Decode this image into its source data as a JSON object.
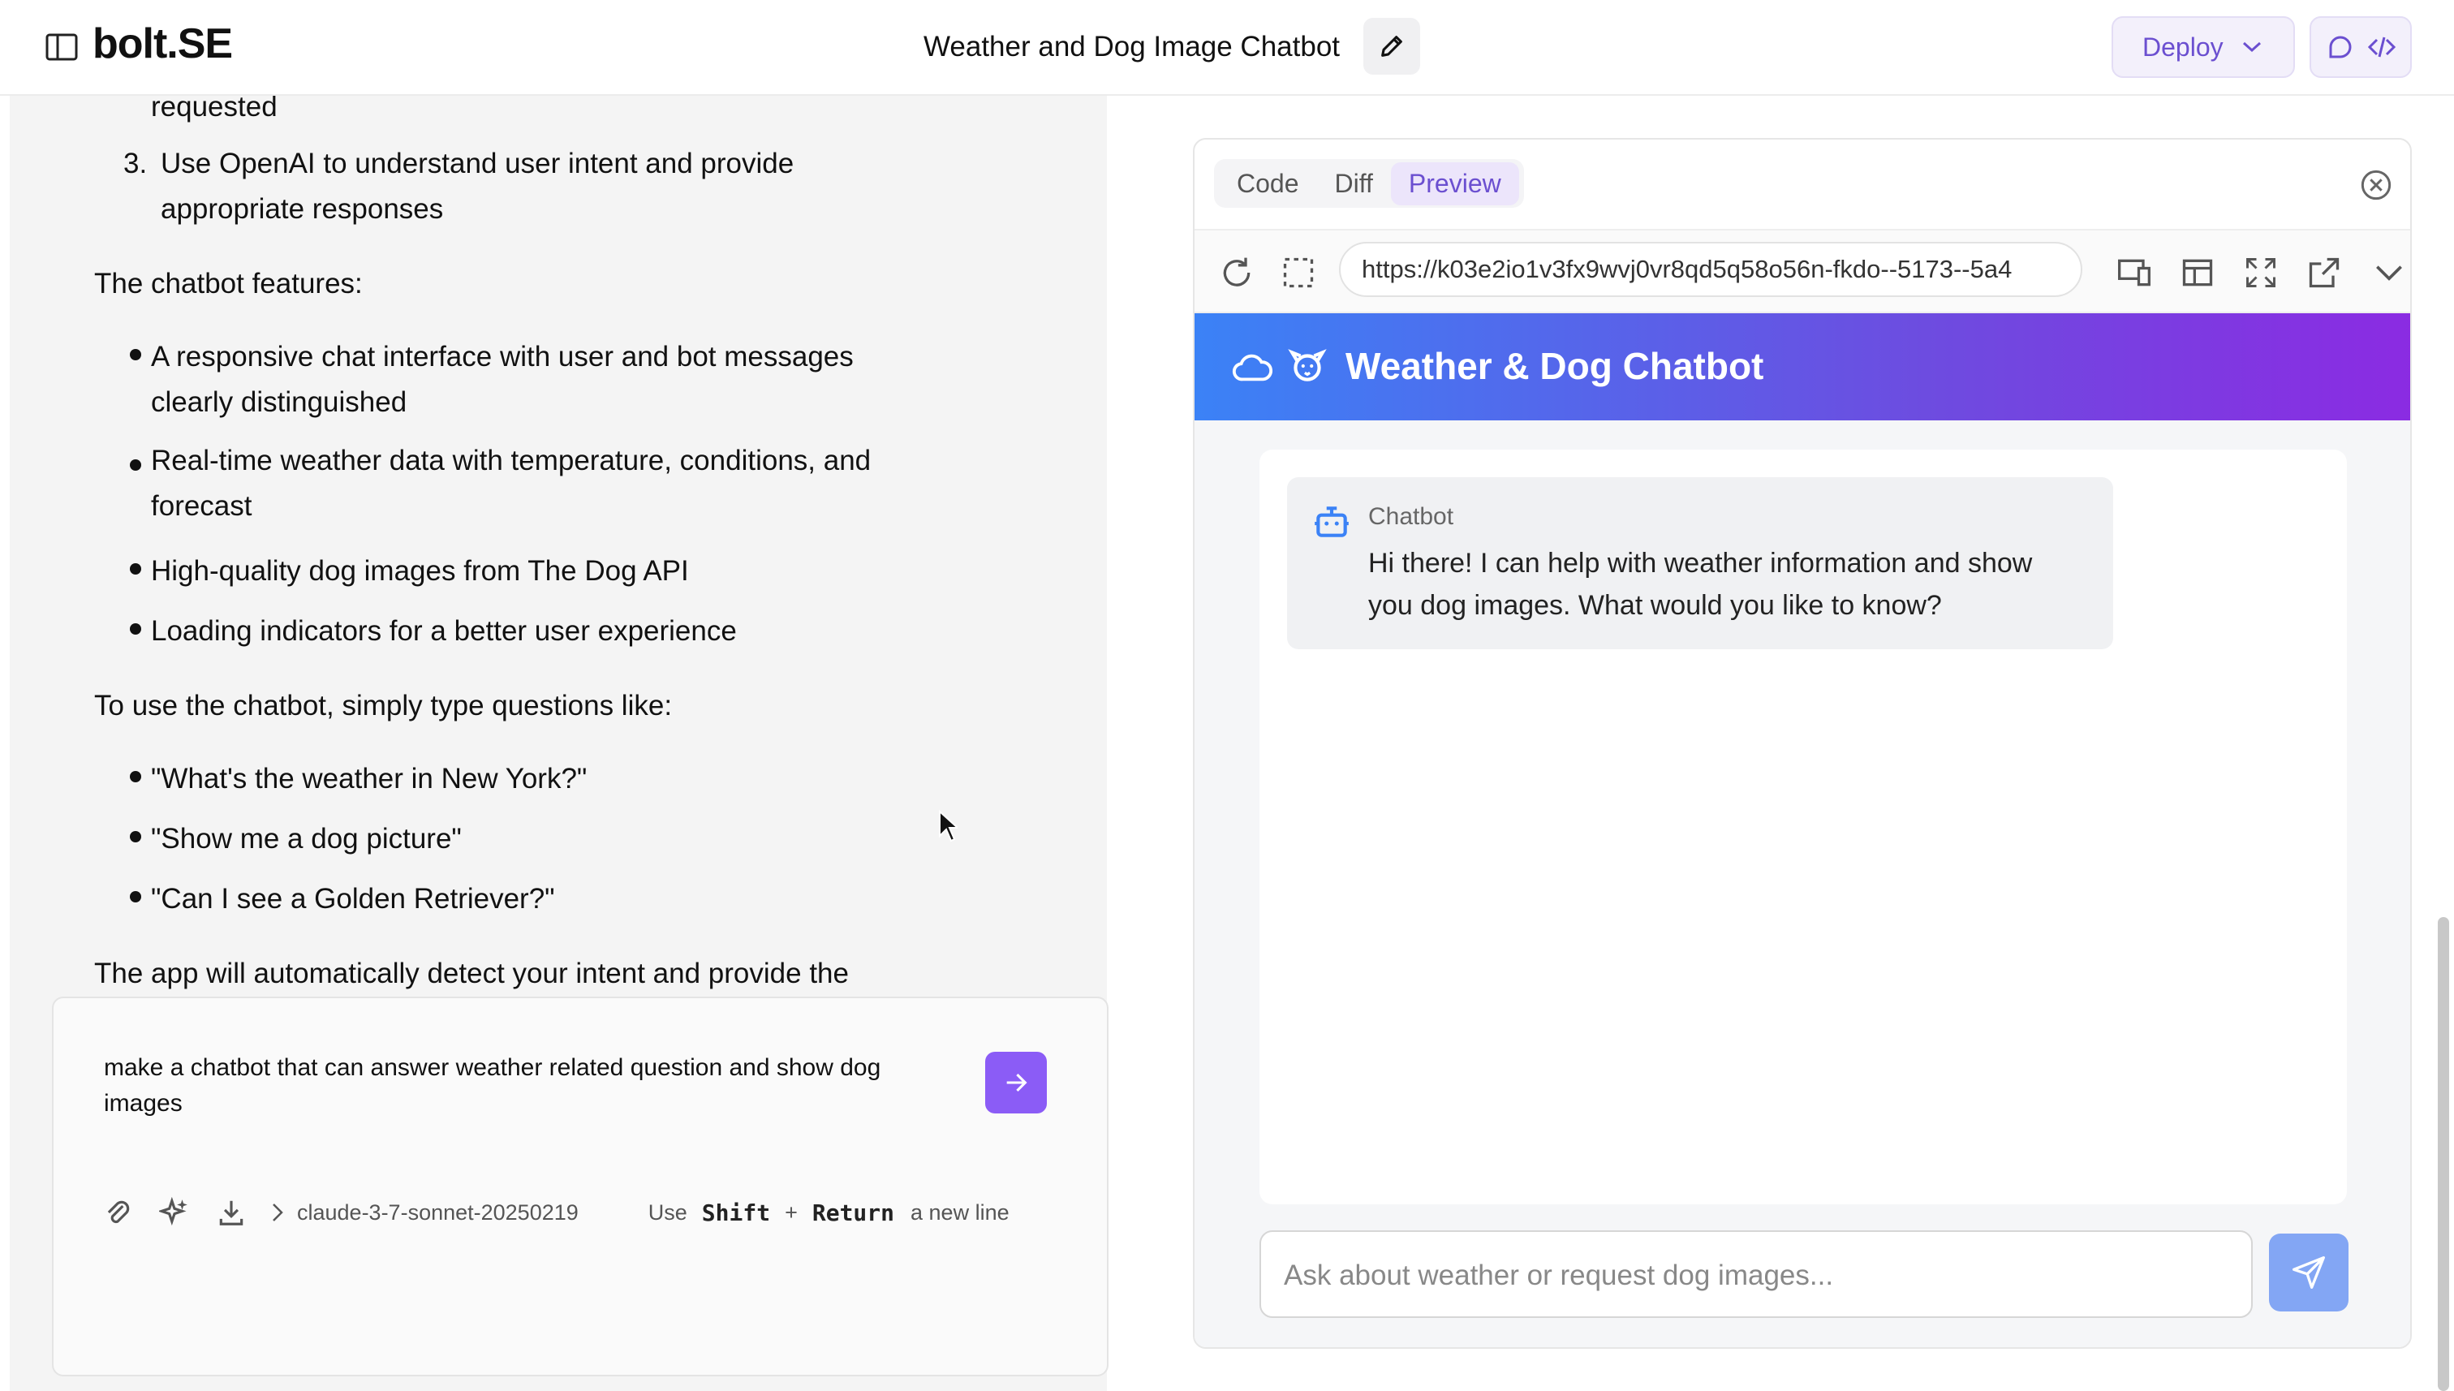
{
  "header": {
    "brand": "bolt.SE",
    "project_title": "Weather and Dog Image Chatbot",
    "deploy_label": "Deploy"
  },
  "chat": {
    "fragment": "requested",
    "ordered_item": {
      "number": "3.",
      "text": "Use OpenAI to understand user intent and provide appropriate responses"
    },
    "features_heading": "The chatbot features:",
    "features": [
      "A responsive chat interface with user and bot messages clearly distinguished",
      "Real-time weather data with temperature, conditions, and forecast",
      "High-quality dog images from The Dog API",
      "Loading indicators for a better user experience"
    ],
    "usage_heading": "To use the chatbot, simply type questions like:",
    "examples": [
      "\"What's the weather in New York?\"",
      "\"Show me a dog picture\"",
      "\"Can I see a Golden Retriever?\""
    ],
    "closing": "The app will automatically detect your intent and provide the appropriate response with either weather information or a dog image."
  },
  "input": {
    "value": "make a chatbot that can answer weather related question and show dog images",
    "model": "claude-3-7-sonnet-20250219",
    "hint_use": "Use",
    "hint_shift": "Shift",
    "hint_plus": "+",
    "hint_return": "Return",
    "hint_rest": "a new line"
  },
  "workbench": {
    "tabs": [
      "Code",
      "Diff",
      "Preview"
    ],
    "active_tab": "Preview",
    "url": "https://k03e2io1v3fx9wvj0vr8qd5q58o56n-fkdo--5173--5a4"
  },
  "preview_app": {
    "title": "Weather & Dog Chatbot",
    "bot_name": "Chatbot",
    "bot_message": "Hi there! I can help with weather information and show you dog images. What would you like to know?",
    "input_placeholder": "Ask about weather or request dog images..."
  },
  "icons": {
    "sidebar_toggle": "sidebar-icon",
    "edit": "pencil-icon",
    "chevron": "chevron-down-icon",
    "attach": "paperclip-icon",
    "enhance": "sparkles-icon",
    "download": "download-icon",
    "reload": "reload-icon",
    "select": "select-element-icon",
    "devices": "device-icon",
    "layout": "layout-icon",
    "fullscreen": "fullscreen-icon",
    "external": "external-link-icon",
    "cloud": "cloud-icon",
    "dog": "dog-icon",
    "bot": "robot-icon",
    "send": "send-icon"
  },
  "colors": {
    "accent": "#8b5cf6",
    "deploy_text": "#6b4fd0",
    "gradient_start": "#3b82f6",
    "gradient_end": "#8b2be2"
  }
}
